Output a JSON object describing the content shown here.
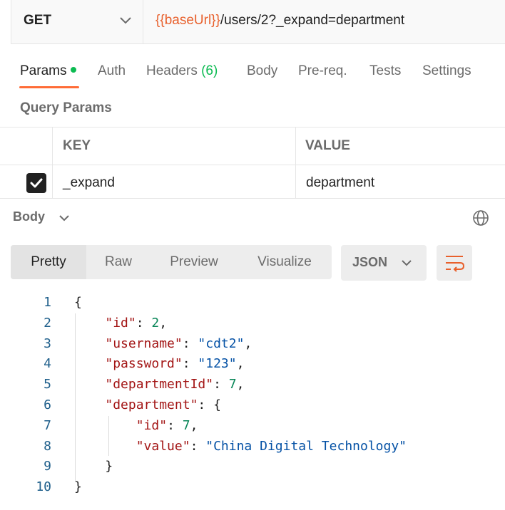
{
  "request": {
    "method": "GET",
    "url_var": "{{baseUrl}}",
    "url_path": "/users/2?_expand=department"
  },
  "tabs": [
    {
      "label": "Params",
      "active": true
    },
    {
      "label": "Auth"
    },
    {
      "label": "Headers",
      "count": "(6)"
    },
    {
      "label": "Body"
    },
    {
      "label": "Pre-req."
    },
    {
      "label": "Tests"
    },
    {
      "label": "Settings"
    }
  ],
  "query_params": {
    "title": "Query Params",
    "headers": {
      "key": "KEY",
      "value": "VALUE"
    },
    "rows": [
      {
        "checked": true,
        "key": "_expand",
        "value": "department"
      }
    ]
  },
  "response": {
    "section_label": "Body",
    "views": [
      "Pretty",
      "Raw",
      "Preview",
      "Visualize"
    ],
    "active_view": "Pretty",
    "format": "JSON",
    "line_numbers": [
      "1",
      "2",
      "3",
      "4",
      "5",
      "6",
      "7",
      "8",
      "9",
      "10"
    ]
  },
  "colors": {
    "accent": "#ff6c37",
    "green": "#0cbb52",
    "var": "#e8602c"
  },
  "icons": [
    "chevron-down-icon",
    "check-icon",
    "globe-icon",
    "wrap-lines-icon"
  ]
}
